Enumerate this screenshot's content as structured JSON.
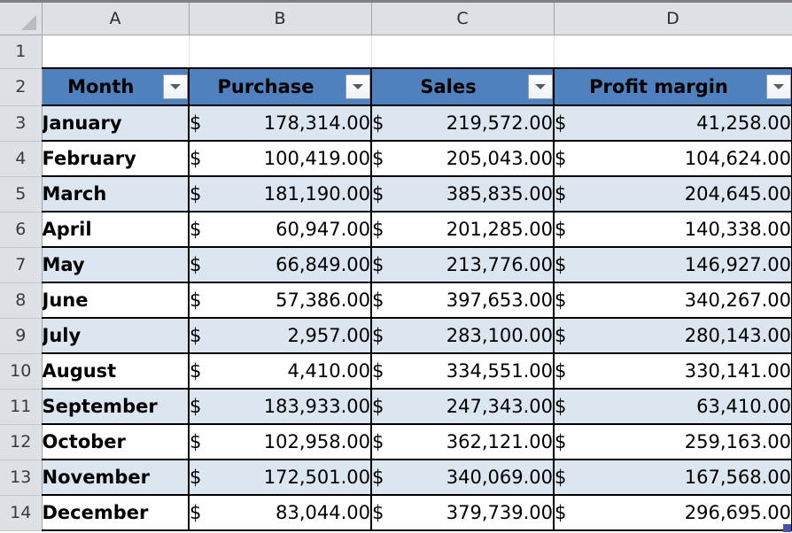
{
  "app": {
    "type": "spreadsheet",
    "select_all_label": "",
    "resize_handle_color": "#4A54A6"
  },
  "colors": {
    "header_fill": "#4E81BD",
    "band_fill": "#DCE6F1",
    "row_header_fill": "#DDE0E5",
    "grid_border": "#000000",
    "handle": "#4A54A6"
  },
  "column_headers": [
    "A",
    "B",
    "C",
    "D"
  ],
  "row_headers": [
    "1",
    "2",
    "3",
    "4",
    "5",
    "6",
    "7",
    "8",
    "9",
    "10",
    "11",
    "12",
    "13",
    "14"
  ],
  "table": {
    "header_row_number": "2",
    "columns": [
      {
        "label": "Month",
        "filter_icon": "chevron-down-icon"
      },
      {
        "label": "Purchase",
        "filter_icon": "chevron-down-icon"
      },
      {
        "label": "Sales",
        "filter_icon": "chevron-down-icon"
      },
      {
        "label": "Profit margin",
        "filter_icon": "chevron-down-icon"
      }
    ],
    "currency_symbol": "$",
    "rows": [
      {
        "row": "3",
        "month": "January",
        "purchase": "178,314.00",
        "sales": "219,572.00",
        "profit": "41,258.00"
      },
      {
        "row": "4",
        "month": "February",
        "purchase": "100,419.00",
        "sales": "205,043.00",
        "profit": "104,624.00"
      },
      {
        "row": "5",
        "month": "March",
        "purchase": "181,190.00",
        "sales": "385,835.00",
        "profit": "204,645.00"
      },
      {
        "row": "6",
        "month": "April",
        "purchase": "60,947.00",
        "sales": "201,285.00",
        "profit": "140,338.00"
      },
      {
        "row": "7",
        "month": "May",
        "purchase": "66,849.00",
        "sales": "213,776.00",
        "profit": "146,927.00"
      },
      {
        "row": "8",
        "month": "June",
        "purchase": "57,386.00",
        "sales": "397,653.00",
        "profit": "340,267.00"
      },
      {
        "row": "9",
        "month": "July",
        "purchase": "2,957.00",
        "sales": "283,100.00",
        "profit": "280,143.00"
      },
      {
        "row": "10",
        "month": "August",
        "purchase": "4,410.00",
        "sales": "334,551.00",
        "profit": "330,141.00"
      },
      {
        "row": "11",
        "month": "September",
        "purchase": "183,933.00",
        "sales": "247,343.00",
        "profit": "63,410.00"
      },
      {
        "row": "12",
        "month": "October",
        "purchase": "102,958.00",
        "sales": "362,121.00",
        "profit": "259,163.00"
      },
      {
        "row": "13",
        "month": "November",
        "purchase": "172,501.00",
        "sales": "340,069.00",
        "profit": "167,568.00"
      },
      {
        "row": "14",
        "month": "December",
        "purchase": "83,044.00",
        "sales": "379,739.00",
        "profit": "296,695.00"
      }
    ]
  }
}
